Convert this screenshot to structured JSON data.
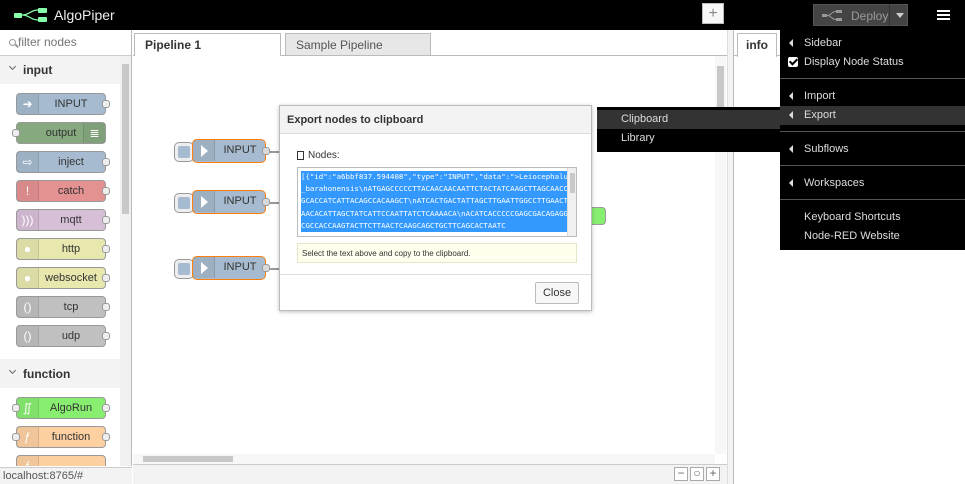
{
  "app": {
    "title": "AlgoPiper",
    "deploy_label": "Deploy"
  },
  "palette": {
    "search_placeholder": "filter nodes",
    "categories": [
      {
        "label": "input",
        "nodes": [
          {
            "label": "INPUT",
            "color": "#a6bbcf"
          },
          {
            "label": "output",
            "color": "#87a980"
          },
          {
            "label": "inject",
            "color": "#a6bbcf"
          },
          {
            "label": "catch",
            "color": "#e49191"
          },
          {
            "label": "mqtt",
            "color": "#d8bfd8"
          },
          {
            "label": "http",
            "color": "#e7e7ae"
          },
          {
            "label": "websocket",
            "color": "#e7e7ae"
          },
          {
            "label": "tcp",
            "color": "#c0c0c0"
          },
          {
            "label": "udp",
            "color": "#c0c0c0"
          }
        ]
      },
      {
        "label": "function",
        "nodes": [
          {
            "label": "AlgoRun",
            "color": "#87ee70"
          },
          {
            "label": "function",
            "color": "#fdd0a2"
          }
        ]
      }
    ]
  },
  "workspace": {
    "tabs": [
      {
        "label": "Pipeline 1"
      },
      {
        "label": "Sample Pipeline"
      }
    ],
    "add_tab_label": "+",
    "nodes": [
      {
        "label": "INPUT"
      },
      {
        "label": "INPUT"
      },
      {
        "label": "INPUT"
      }
    ],
    "zoom_out": "−",
    "zoom_reset": "○",
    "zoom_in": "+"
  },
  "status_url": "localhost:8765/#",
  "sidebar": {
    "tab_label": "info"
  },
  "export_dialog": {
    "title": "Export nodes to clipboard",
    "nodes_label": "Nodes:",
    "text": "[{\"id\":\"a6bbf837.594408\",\"type\":\"INPUT\",\"data\":\">Leiocephalus_barahonensis\\nATGAGCCCCCTTACAACAACAATTCTACTATCAAGCTTAGCAACCGGCACCATCATTACAGCCACAAGCT\\nATCACTGACTATTAGCTTGAATTGGCCTTGAACTAAACACATTAGCTATCATTCCAATTATCTCAAAACA\\nACATCACCCCCGAGCGACAGAGGCCGCCACCAAGTACTTCTTAACTCAAGCAGCTGCTTCAGCACTAATC",
    "hint": "Select the text above and copy to the clipboard.",
    "close_label": "Close"
  },
  "main_menu": {
    "items": [
      {
        "label": "Sidebar",
        "kind": "submenu"
      },
      {
        "label": "Display Node Status",
        "kind": "checkbox",
        "checked": true
      },
      {
        "label": "Import",
        "kind": "submenu"
      },
      {
        "label": "Export",
        "kind": "submenu",
        "active": true
      },
      {
        "label": "Subflows",
        "kind": "submenu"
      },
      {
        "label": "Workspaces",
        "kind": "submenu"
      },
      {
        "label": "Keyboard Shortcuts",
        "kind": "plain"
      },
      {
        "label": "Node-RED Website",
        "kind": "plain"
      }
    ]
  },
  "export_submenu": {
    "items": [
      {
        "label": "Clipboard",
        "active": true
      },
      {
        "label": "Library"
      }
    ]
  },
  "colors": {
    "header_bg": "#000000",
    "selected_node_border": "#ff7f0e",
    "input_node": "#a6bbcf",
    "selection": "#3399ff"
  }
}
